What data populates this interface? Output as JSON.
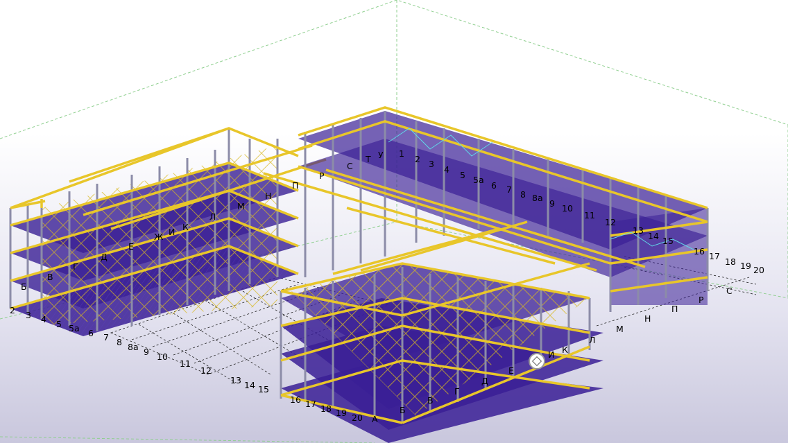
{
  "scene": {
    "colors": {
      "beam": "#e8c62a",
      "column": "#8c8ca8",
      "slab": "#3a1f95",
      "brace": "#d8b820",
      "gridline": "#222222",
      "boundingBox": "#8fcf8f",
      "cyan": "#5fd8e8"
    }
  },
  "axes": {
    "left_letters": [
      "Б",
      "В",
      "Г",
      "Д",
      "Е",
      "Ж",
      "И",
      "К",
      "Л",
      "М",
      "Н",
      "П",
      "Р",
      "С",
      "Т",
      "У"
    ],
    "left_numbers": [
      "2",
      "3",
      "4",
      "5",
      "5а",
      "6",
      "7",
      "8",
      "8а",
      "9",
      "10",
      "11",
      "12",
      "13",
      "14",
      "15"
    ],
    "right_numbers": [
      "1",
      "2",
      "3",
      "4",
      "5",
      "5а",
      "6",
      "7",
      "8",
      "8а",
      "9",
      "10",
      "11",
      "12",
      "13",
      "14",
      "15",
      "16",
      "17",
      "18",
      "19",
      "20"
    ],
    "right_letters": [
      "С",
      "Р",
      "П",
      "Н",
      "М",
      "Л",
      "К",
      "И"
    ],
    "front_numbers": [
      "16",
      "17",
      "18",
      "19",
      "20",
      "А"
    ],
    "front_letters": [
      "Б",
      "В",
      "Г",
      "Д",
      "Е"
    ]
  },
  "tools": {
    "nav_cube": "view-cube-icon"
  }
}
